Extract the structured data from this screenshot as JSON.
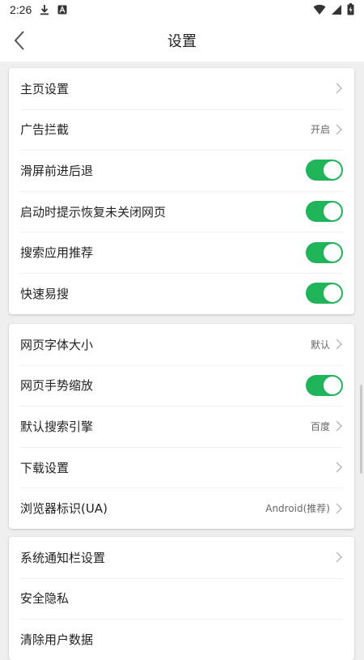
{
  "status_bar": {
    "time": "2:26",
    "icons": [
      "download-icon",
      "app-notification-icon",
      "wifi-icon",
      "signal-icon",
      "battery-icon"
    ]
  },
  "header": {
    "back_icon": "back-arrow-icon",
    "title": "设置"
  },
  "colors": {
    "toggle_on": "#1fb35a",
    "background": "#efefef",
    "card": "#ffffff"
  },
  "groups": [
    {
      "items": [
        {
          "label": "主页设置",
          "value": "",
          "control": "chevron"
        },
        {
          "label": "广告拦截",
          "value": "开启",
          "control": "chevron"
        },
        {
          "label": "滑屏前进后退",
          "value": "",
          "control": "toggle",
          "on": true
        },
        {
          "label": "启动时提示恢复未关闭网页",
          "value": "",
          "control": "toggle",
          "on": true
        },
        {
          "label": "搜索应用推荐",
          "value": "",
          "control": "toggle",
          "on": true
        },
        {
          "label": "快速易搜",
          "value": "",
          "control": "toggle",
          "on": true
        }
      ]
    },
    {
      "items": [
        {
          "label": "网页字体大小",
          "value": "默认",
          "control": "chevron"
        },
        {
          "label": "网页手势缩放",
          "value": "",
          "control": "toggle",
          "on": true
        },
        {
          "label": "默认搜索引擎",
          "value": "百度",
          "control": "chevron"
        },
        {
          "label": "下载设置",
          "value": "",
          "control": "chevron"
        },
        {
          "label": "浏览器标识(UA)",
          "value": "Android(推荐)",
          "control": "chevron"
        }
      ]
    },
    {
      "items": [
        {
          "label": "系统通知栏设置",
          "value": "",
          "control": "chevron"
        },
        {
          "label": "安全隐私",
          "value": "",
          "control": "none"
        },
        {
          "label": "清除用户数据",
          "value": "",
          "control": "none"
        }
      ]
    }
  ]
}
